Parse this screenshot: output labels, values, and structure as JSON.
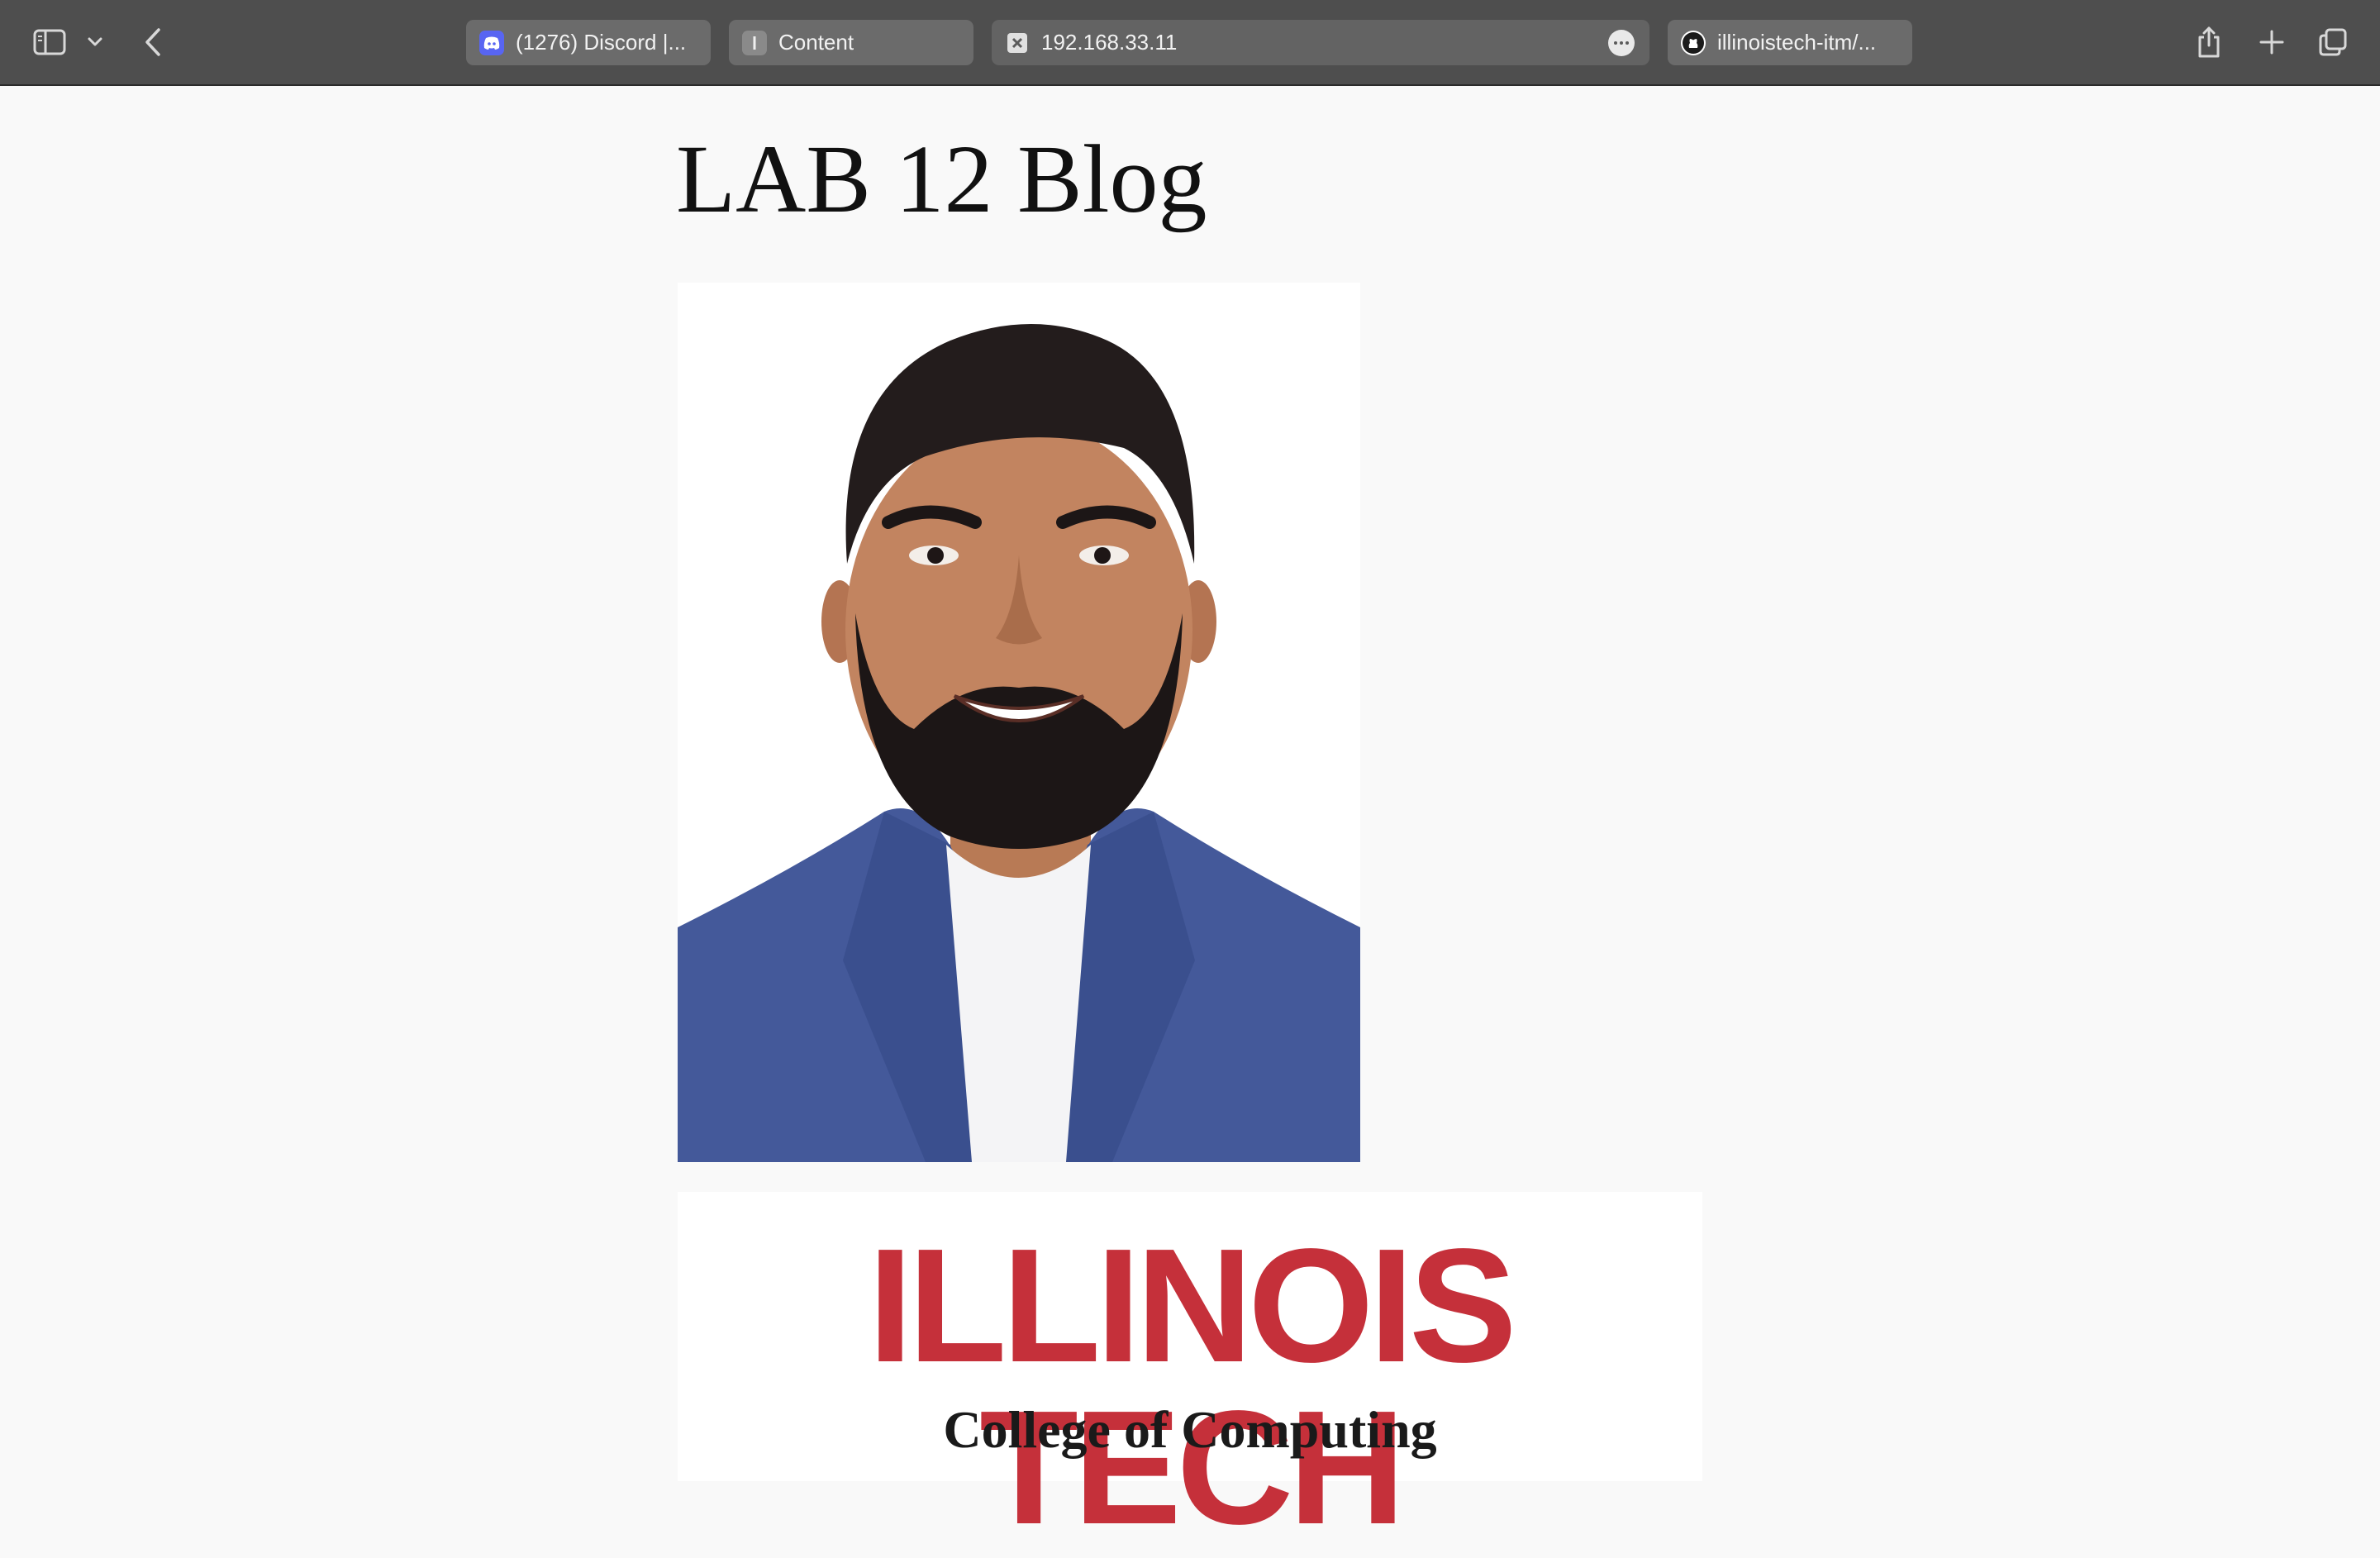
{
  "browser": {
    "tabs": [
      {
        "label": "(1276) Discord |...",
        "icon": "discord-icon",
        "color": "#5865f2"
      },
      {
        "label": "Content",
        "icon": "page-favicon-icon",
        "color": "#8a8a8a"
      },
      {
        "label": "192.168.33.11",
        "icon": "broken-favicon-icon",
        "color": "#e0e0e0",
        "active": true
      },
      {
        "label": "illinoistech-itm/...",
        "icon": "github-icon",
        "color": "#ffffff"
      }
    ],
    "colors": {
      "toolbar": "#4e4e4e",
      "tab": "#6b6b6b"
    }
  },
  "page": {
    "title": "LAB 12 Blog",
    "logo": {
      "main": "ILLINOIS TECH",
      "sub": "College of Computing",
      "color": "#c5303a"
    }
  }
}
